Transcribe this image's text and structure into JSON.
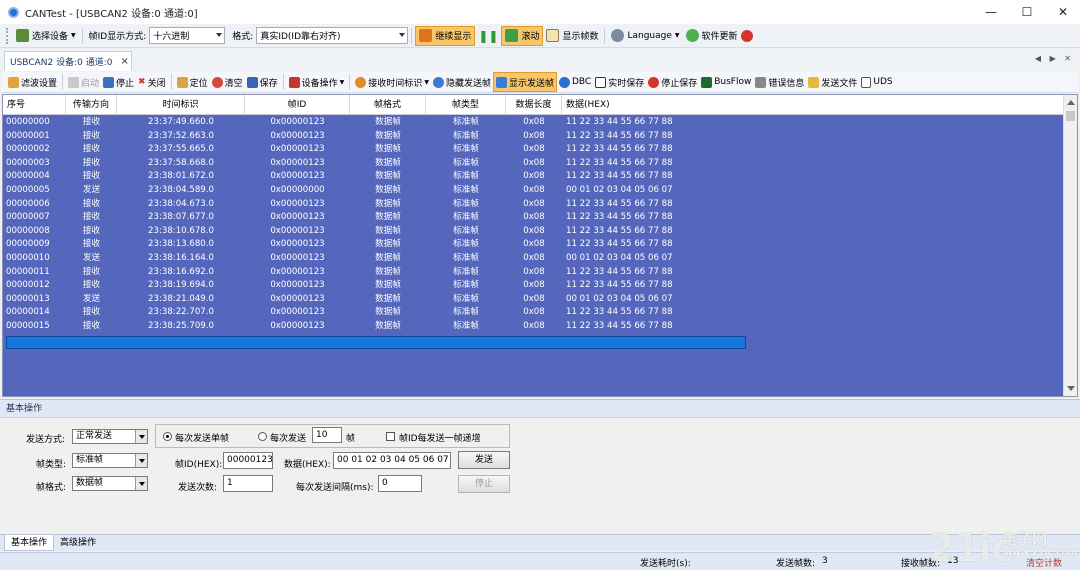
{
  "window": {
    "title": "CANTest  - [USBCAN2 设备:0 通道:0]",
    "minimize": "—",
    "maximize": "☐",
    "close": "✕"
  },
  "toolbar": {
    "select_device": "选择设备",
    "frame_id_format_label": "帧ID显示方式:",
    "frame_id_format_value": "十六进制",
    "format_label": "格式:",
    "format_value": "真实ID(ID靠右对齐)",
    "continue_display": "继续显示",
    "scroll": "滚动",
    "show_frame_count": "显示帧数",
    "language": "Language",
    "software_update": "软件更新"
  },
  "tab": {
    "label": "USBCAN2 设备:0 通道:0",
    "close": "×",
    "arrows": "◀ ▶ ✕"
  },
  "subtoolbar": {
    "filter_settings": "滤波设置",
    "start": "启动",
    "stop": "停止",
    "close": "关闭",
    "locate": "定位",
    "clear": "清空",
    "save": "保存",
    "device_ops": "设备操作",
    "recv_time_id": "接收时间标识",
    "hide_sent_frames": "隐藏发送帧",
    "show_sent_frames": "显示发送帧",
    "dbc": "DBC",
    "realtime_save": "实时保存",
    "stop_save": "停止保存",
    "busflow": "BusFlow",
    "error_info": "错误信息",
    "send_file": "发送文件",
    "uds": "UDS"
  },
  "table": {
    "columns": [
      "序号",
      "传输方向",
      "时间标识",
      "帧ID",
      "帧格式",
      "帧类型",
      "数据长度",
      "数据(HEX)"
    ],
    "rows": [
      [
        "00000000",
        "接收",
        "23:37:49.660.0",
        "0x00000123",
        "数据帧",
        "标准帧",
        "0x08",
        "11 22 33 44 55 66 77 88"
      ],
      [
        "00000001",
        "接收",
        "23:37:52.663.0",
        "0x00000123",
        "数据帧",
        "标准帧",
        "0x08",
        "11 22 33 44 55 66 77 88"
      ],
      [
        "00000002",
        "接收",
        "23:37:55.665.0",
        "0x00000123",
        "数据帧",
        "标准帧",
        "0x08",
        "11 22 33 44 55 66 77 88"
      ],
      [
        "00000003",
        "接收",
        "23:37:58.668.0",
        "0x00000123",
        "数据帧",
        "标准帧",
        "0x08",
        "11 22 33 44 55 66 77 88"
      ],
      [
        "00000004",
        "接收",
        "23:38:01.672.0",
        "0x00000123",
        "数据帧",
        "标准帧",
        "0x08",
        "11 22 33 44 55 66 77 88"
      ],
      [
        "00000005",
        "发送",
        "23:38:04.589.0",
        "0x00000000",
        "数据帧",
        "标准帧",
        "0x08",
        "00 01 02 03 04 05 06 07"
      ],
      [
        "00000006",
        "接收",
        "23:38:04.673.0",
        "0x00000123",
        "数据帧",
        "标准帧",
        "0x08",
        "11 22 33 44 55 66 77 88"
      ],
      [
        "00000007",
        "接收",
        "23:38:07.677.0",
        "0x00000123",
        "数据帧",
        "标准帧",
        "0x08",
        "11 22 33 44 55 66 77 88"
      ],
      [
        "00000008",
        "接收",
        "23:38:10.678.0",
        "0x00000123",
        "数据帧",
        "标准帧",
        "0x08",
        "11 22 33 44 55 66 77 88"
      ],
      [
        "00000009",
        "接收",
        "23:38:13.680.0",
        "0x00000123",
        "数据帧",
        "标准帧",
        "0x08",
        "11 22 33 44 55 66 77 88"
      ],
      [
        "00000010",
        "发送",
        "23:38:16.164.0",
        "0x00000123",
        "数据帧",
        "标准帧",
        "0x08",
        "00 01 02 03 04 05 06 07"
      ],
      [
        "00000011",
        "接收",
        "23:38:16.692.0",
        "0x00000123",
        "数据帧",
        "标准帧",
        "0x08",
        "11 22 33 44 55 66 77 88"
      ],
      [
        "00000012",
        "接收",
        "23:38:19.694.0",
        "0x00000123",
        "数据帧",
        "标准帧",
        "0x08",
        "11 22 33 44 55 66 77 88"
      ],
      [
        "00000013",
        "发送",
        "23:38:21.049.0",
        "0x00000123",
        "数据帧",
        "标准帧",
        "0x08",
        "00 01 02 03 04 05 06 07"
      ],
      [
        "00000014",
        "接收",
        "23:38:22.707.0",
        "0x00000123",
        "数据帧",
        "标准帧",
        "0x08",
        "11 22 33 44 55 66 77 88"
      ],
      [
        "00000015",
        "接收",
        "23:38:25.709.0",
        "0x00000123",
        "数据帧",
        "标准帧",
        "0x08",
        "11 22 33 44 55 66 77 88"
      ]
    ]
  },
  "panel": {
    "header": "基本操作",
    "send_mode_label": "发送方式:",
    "send_mode_value": "正常发送",
    "radio_single": "每次发送单帧",
    "radio_multi": "每次发送",
    "multi_count": "10",
    "multi_unit": "帧",
    "id_increment": "帧ID每发送一帧递增",
    "frame_type_label": "帧类型:",
    "frame_type_value": "标准帧",
    "frame_id_label": "帧ID(HEX):",
    "frame_id_value": "00000123",
    "data_label": "数据(HEX):",
    "data_value": "00 01 02 03 04 05 06 07",
    "send_button": "发送",
    "frame_format_label": "帧格式:",
    "frame_format_value": "数据帧",
    "send_count_label": "发送次数:",
    "send_count_value": "1",
    "interval_label": "每次发送间隔(ms):",
    "interval_value": "0",
    "stop_button": "停止"
  },
  "bottom_tabs": {
    "basic": "基本操作",
    "advanced": "高级操作"
  },
  "status": {
    "send_time_label": "发送耗时(s):",
    "sent_frames_label": "发送帧数:",
    "sent_frames_value": "3",
    "recv_frames_label": "接收帧数:",
    "recv_frames_value": "13",
    "clear_count": "清空计数"
  },
  "watermark": {
    "logo": "21ic",
    "cn": "电子网",
    "url": "www.21ic.com"
  },
  "colors": {
    "grid_bg": "#5567bd",
    "selected_row": "#1677d8",
    "highlight_btn": "#f8c66a"
  }
}
